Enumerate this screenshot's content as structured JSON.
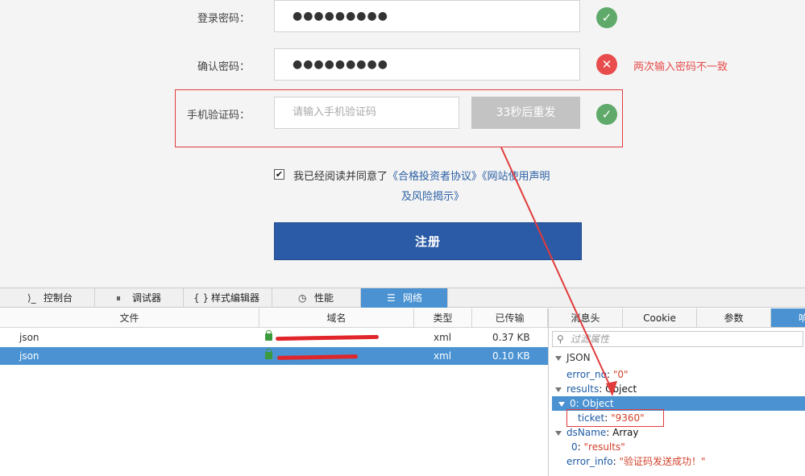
{
  "form": {
    "password_label": "登录密码：",
    "password_value": "●●●●●●●●●",
    "confirm_label": "确认密码：",
    "confirm_value": "●●●●●●●●●",
    "confirm_error": "两次输入密码不一致",
    "sms_label": "手机验证码：",
    "sms_placeholder": "请输入手机验证码",
    "resend_label": "33秒后重发",
    "agree_text": "我已经阅读并同意了",
    "agree_link1": "《合格投资者协议》",
    "agree_link2a": "《网站使用声明",
    "agree_link2b": "及风险揭示》",
    "submit_label": "注册",
    "checkbox_mark": "✔"
  },
  "devtools": {
    "tabs": [
      {
        "label": "控制台",
        "icon": "console-icon",
        "glyph": "⟩_"
      },
      {
        "label": "调试器",
        "icon": "debugger-icon",
        "glyph": "⏸"
      },
      {
        "label": "样式编辑器",
        "icon": "style-editor-icon",
        "glyph": "{ }"
      },
      {
        "label": "性能",
        "icon": "performance-icon",
        "glyph": "◷"
      },
      {
        "label": "网络",
        "icon": "network-icon",
        "glyph": "☰"
      }
    ],
    "columns": [
      "文件",
      "域名",
      "类型",
      "已传输"
    ],
    "rows": [
      {
        "file": "json",
        "type": "xml",
        "size": "0.37 KB"
      },
      {
        "file": "json",
        "type": "xml",
        "size": "0.10 KB"
      }
    ],
    "detail_tabs": [
      "消息头",
      "Cookie",
      "参数",
      "响应"
    ],
    "filter_placeholder": "过滤属性",
    "tree": {
      "root": "JSON",
      "error_no_key": "error_no",
      "error_no_val": "\"0\"",
      "results_key": "results",
      "results_val": "Object",
      "obj0_key": "0",
      "obj0_val": "Object",
      "ticket_key": "ticket",
      "ticket_val": "\"9360\"",
      "dsname_key": "dsName",
      "dsname_val": "Array",
      "ds0_key": "0",
      "ds0_val": "\"results\"",
      "error_info_key": "error_info",
      "error_info_val": "\"验证码发送成功！\""
    }
  },
  "colors": {
    "accent": "#4a92d2",
    "submit": "#2b5ba6",
    "ok": "#5faa6a",
    "error": "#e84c4c"
  }
}
